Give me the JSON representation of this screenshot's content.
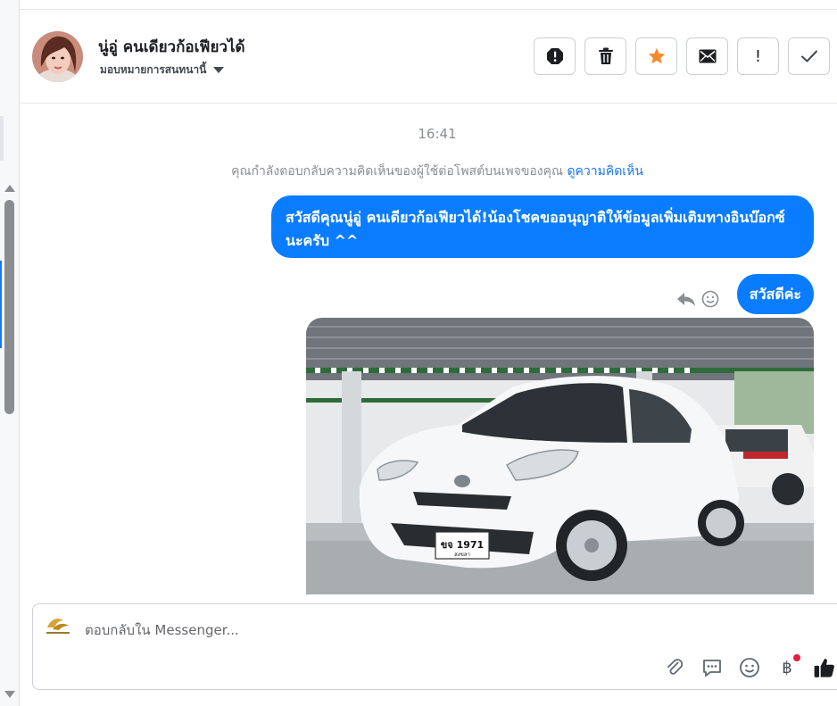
{
  "header": {
    "contact_name": "นู่อู่ คนเดียวก้อเฟียวได้",
    "assign_label": "มอบหมายการสนทนานี้",
    "actions": [
      {
        "name": "spam-button",
        "icon": "alert-octagon-icon"
      },
      {
        "name": "delete-button",
        "icon": "trash-icon"
      },
      {
        "name": "star-button",
        "icon": "star-icon"
      },
      {
        "name": "mark-unread-button",
        "icon": "envelope-icon"
      },
      {
        "name": "follow-up-button",
        "icon": "exclamation-icon",
        "label": "!"
      },
      {
        "name": "mark-done-button",
        "icon": "checkmark-icon"
      }
    ]
  },
  "conversation": {
    "timestamp": "16:41",
    "context_note": "คุณกำลังตอบกลับความคิดเห็นของผู้ใช้ต่อโพสต์บนเพจของคุณ",
    "context_link": "ดูความคิดเห็น",
    "messages": [
      {
        "text": "สวัสดีคุณนู่อู่ คนเดียวก้อเฟียวได้!น้องโชคขออนุญาติให้ข้อมูลเพิ่มเติมทางอินบ๊อกซ์นะครับ ^^"
      },
      {
        "text": "สวัสดีค่ะ"
      }
    ],
    "photo": {
      "plate": "ขจ 1971",
      "plate_province": "สงขลา"
    }
  },
  "composer": {
    "placeholder": "ตอบกลับใน Messenger...",
    "tools": [
      "paperclip-icon",
      "chat-bubble-icon",
      "emoji-icon",
      "baht-icon",
      "thumbs-up-icon"
    ],
    "baht_symbol": "฿"
  },
  "colors": {
    "accent": "#0a7cff",
    "star": "#f5892a",
    "link": "#1877f2"
  }
}
